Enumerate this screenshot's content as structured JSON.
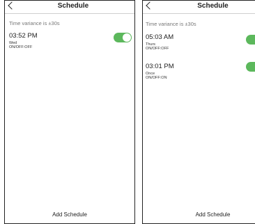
{
  "screens": [
    {
      "title": "Schedule",
      "variance": "Time variance is  ±30s",
      "entries": [
        {
          "time": "03:52 PM",
          "day": "Wed",
          "state": "ON/OFF:OFF",
          "toggle_on": true
        }
      ],
      "add_label": "Add Schedule"
    },
    {
      "title": "Schedule",
      "variance": "Time variance is  ±30s",
      "entries": [
        {
          "time": "05:03 AM",
          "day": "Thurs",
          "state": "ON/OFF:OFF",
          "toggle_on": true
        },
        {
          "time": "03:01 PM",
          "day": "Once",
          "state": "ON/OFF:ON",
          "toggle_on": true
        }
      ],
      "add_label": "Add Schedule"
    }
  ],
  "colors": {
    "toggle_on": "#5cb85c"
  },
  "icons": {
    "back": "chevron-left-icon"
  }
}
